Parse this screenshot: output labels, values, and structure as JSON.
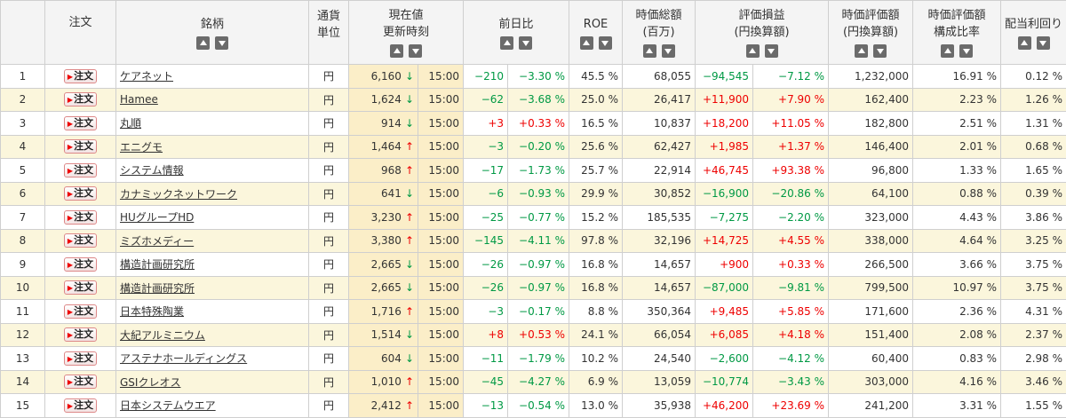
{
  "headers": {
    "no": "",
    "order": "注文",
    "name": "銘柄",
    "currency_l1": "通貨",
    "currency_l2": "単位",
    "price_l1": "現在値",
    "price_l2": "更新時刻",
    "change": "前日比",
    "roe": "ROE",
    "mcap_l1": "時価総額",
    "mcap_l2": "(百万)",
    "pl_l1": "評価損益",
    "pl_l2": "(円換算額)",
    "mval_l1": "時価評価額",
    "mval_l2": "(円換算額)",
    "ratio_l1": "時価評価額",
    "ratio_l2": "構成比率",
    "yield": "配当利回り"
  },
  "order_label": "注文",
  "colors": {
    "up": "#e00000",
    "down": "#009944",
    "row_alt": "#fbf6dc"
  },
  "rows": [
    {
      "no": "1",
      "name": "ケアネット",
      "cur": "円",
      "price": "6,160",
      "dir": "down",
      "time": "15:00",
      "chg": "−210",
      "chgp": "−3.30 %",
      "chg_sign": "neg",
      "roe": "45.5 %",
      "mcap": "68,055",
      "pl": "−94,545",
      "plp": "−7.12 %",
      "pl_sign": "neg",
      "mval": "1,232,000",
      "ratio": "16.91 %",
      "yield": "0.12 %"
    },
    {
      "no": "2",
      "name": "Hamee",
      "cur": "円",
      "price": "1,624",
      "dir": "down",
      "time": "15:00",
      "chg": "−62",
      "chgp": "−3.68 %",
      "chg_sign": "neg",
      "roe": "25.0 %",
      "mcap": "26,417",
      "pl": "+11,900",
      "plp": "+7.90 %",
      "pl_sign": "pos",
      "mval": "162,400",
      "ratio": "2.23 %",
      "yield": "1.26 %"
    },
    {
      "no": "3",
      "name": "丸順",
      "cur": "円",
      "price": "914",
      "dir": "down",
      "time": "15:00",
      "chg": "+3",
      "chgp": "+0.33 %",
      "chg_sign": "pos",
      "roe": "16.5 %",
      "mcap": "10,837",
      "pl": "+18,200",
      "plp": "+11.05 %",
      "pl_sign": "pos",
      "mval": "182,800",
      "ratio": "2.51 %",
      "yield": "1.31 %"
    },
    {
      "no": "4",
      "name": "エニグモ",
      "cur": "円",
      "price": "1,464",
      "dir": "up",
      "time": "15:00",
      "chg": "−3",
      "chgp": "−0.20 %",
      "chg_sign": "neg",
      "roe": "25.6 %",
      "mcap": "62,427",
      "pl": "+1,985",
      "plp": "+1.37 %",
      "pl_sign": "pos",
      "mval": "146,400",
      "ratio": "2.01 %",
      "yield": "0.68 %"
    },
    {
      "no": "5",
      "name": "システム情報",
      "cur": "円",
      "price": "968",
      "dir": "up",
      "time": "15:00",
      "chg": "−17",
      "chgp": "−1.73 %",
      "chg_sign": "neg",
      "roe": "25.7 %",
      "mcap": "22,914",
      "pl": "+46,745",
      "plp": "+93.38 %",
      "pl_sign": "pos",
      "mval": "96,800",
      "ratio": "1.33 %",
      "yield": "1.65 %"
    },
    {
      "no": "6",
      "name": "カナミックネットワーク",
      "cur": "円",
      "price": "641",
      "dir": "down",
      "time": "15:00",
      "chg": "−6",
      "chgp": "−0.93 %",
      "chg_sign": "neg",
      "roe": "29.9 %",
      "mcap": "30,852",
      "pl": "−16,900",
      "plp": "−20.86 %",
      "pl_sign": "neg",
      "mval": "64,100",
      "ratio": "0.88 %",
      "yield": "0.39 %"
    },
    {
      "no": "7",
      "name": "HUグループHD",
      "cur": "円",
      "price": "3,230",
      "dir": "up",
      "time": "15:00",
      "chg": "−25",
      "chgp": "−0.77 %",
      "chg_sign": "neg",
      "roe": "15.2 %",
      "mcap": "185,535",
      "pl": "−7,275",
      "plp": "−2.20 %",
      "pl_sign": "neg",
      "mval": "323,000",
      "ratio": "4.43 %",
      "yield": "3.86 %"
    },
    {
      "no": "8",
      "name": "ミズホメディー",
      "cur": "円",
      "price": "3,380",
      "dir": "up",
      "time": "15:00",
      "chg": "−145",
      "chgp": "−4.11 %",
      "chg_sign": "neg",
      "roe": "97.8 %",
      "mcap": "32,196",
      "pl": "+14,725",
      "plp": "+4.55 %",
      "pl_sign": "pos",
      "mval": "338,000",
      "ratio": "4.64 %",
      "yield": "3.25 %"
    },
    {
      "no": "9",
      "name": "構造計画研究所",
      "cur": "円",
      "price": "2,665",
      "dir": "down",
      "time": "15:00",
      "chg": "−26",
      "chgp": "−0.97 %",
      "chg_sign": "neg",
      "roe": "16.8 %",
      "mcap": "14,657",
      "pl": "+900",
      "plp": "+0.33 %",
      "pl_sign": "pos",
      "mval": "266,500",
      "ratio": "3.66 %",
      "yield": "3.75 %"
    },
    {
      "no": "10",
      "name": "構造計画研究所",
      "cur": "円",
      "price": "2,665",
      "dir": "down",
      "time": "15:00",
      "chg": "−26",
      "chgp": "−0.97 %",
      "chg_sign": "neg",
      "roe": "16.8 %",
      "mcap": "14,657",
      "pl": "−87,000",
      "plp": "−9.81 %",
      "pl_sign": "neg",
      "mval": "799,500",
      "ratio": "10.97 %",
      "yield": "3.75 %"
    },
    {
      "no": "11",
      "name": "日本特殊陶業",
      "cur": "円",
      "price": "1,716",
      "dir": "up",
      "time": "15:00",
      "chg": "−3",
      "chgp": "−0.17 %",
      "chg_sign": "neg",
      "roe": "8.8 %",
      "mcap": "350,364",
      "pl": "+9,485",
      "plp": "+5.85 %",
      "pl_sign": "pos",
      "mval": "171,600",
      "ratio": "2.36 %",
      "yield": "4.31 %"
    },
    {
      "no": "12",
      "name": "大紀アルミニウム",
      "cur": "円",
      "price": "1,514",
      "dir": "down",
      "time": "15:00",
      "chg": "+8",
      "chgp": "+0.53 %",
      "chg_sign": "pos",
      "roe": "24.1 %",
      "mcap": "66,054",
      "pl": "+6,085",
      "plp": "+4.18 %",
      "pl_sign": "pos",
      "mval": "151,400",
      "ratio": "2.08 %",
      "yield": "2.37 %"
    },
    {
      "no": "13",
      "name": "アステナホールディングス",
      "cur": "円",
      "price": "604",
      "dir": "down",
      "time": "15:00",
      "chg": "−11",
      "chgp": "−1.79 %",
      "chg_sign": "neg",
      "roe": "10.2 %",
      "mcap": "24,540",
      "pl": "−2,600",
      "plp": "−4.12 %",
      "pl_sign": "neg",
      "mval": "60,400",
      "ratio": "0.83 %",
      "yield": "2.98 %"
    },
    {
      "no": "14",
      "name": "GSIクレオス",
      "cur": "円",
      "price": "1,010",
      "dir": "up",
      "time": "15:00",
      "chg": "−45",
      "chgp": "−4.27 %",
      "chg_sign": "neg",
      "roe": "6.9 %",
      "mcap": "13,059",
      "pl": "−10,774",
      "plp": "−3.43 %",
      "pl_sign": "neg",
      "mval": "303,000",
      "ratio": "4.16 %",
      "yield": "3.46 %"
    },
    {
      "no": "15",
      "name": "日本システムウエア",
      "cur": "円",
      "price": "2,412",
      "dir": "up",
      "time": "15:00",
      "chg": "−13",
      "chgp": "−0.54 %",
      "chg_sign": "neg",
      "roe": "13.0 %",
      "mcap": "35,938",
      "pl": "+46,200",
      "plp": "+23.69 %",
      "pl_sign": "pos",
      "mval": "241,200",
      "ratio": "3.31 %",
      "yield": "1.55 %"
    }
  ]
}
